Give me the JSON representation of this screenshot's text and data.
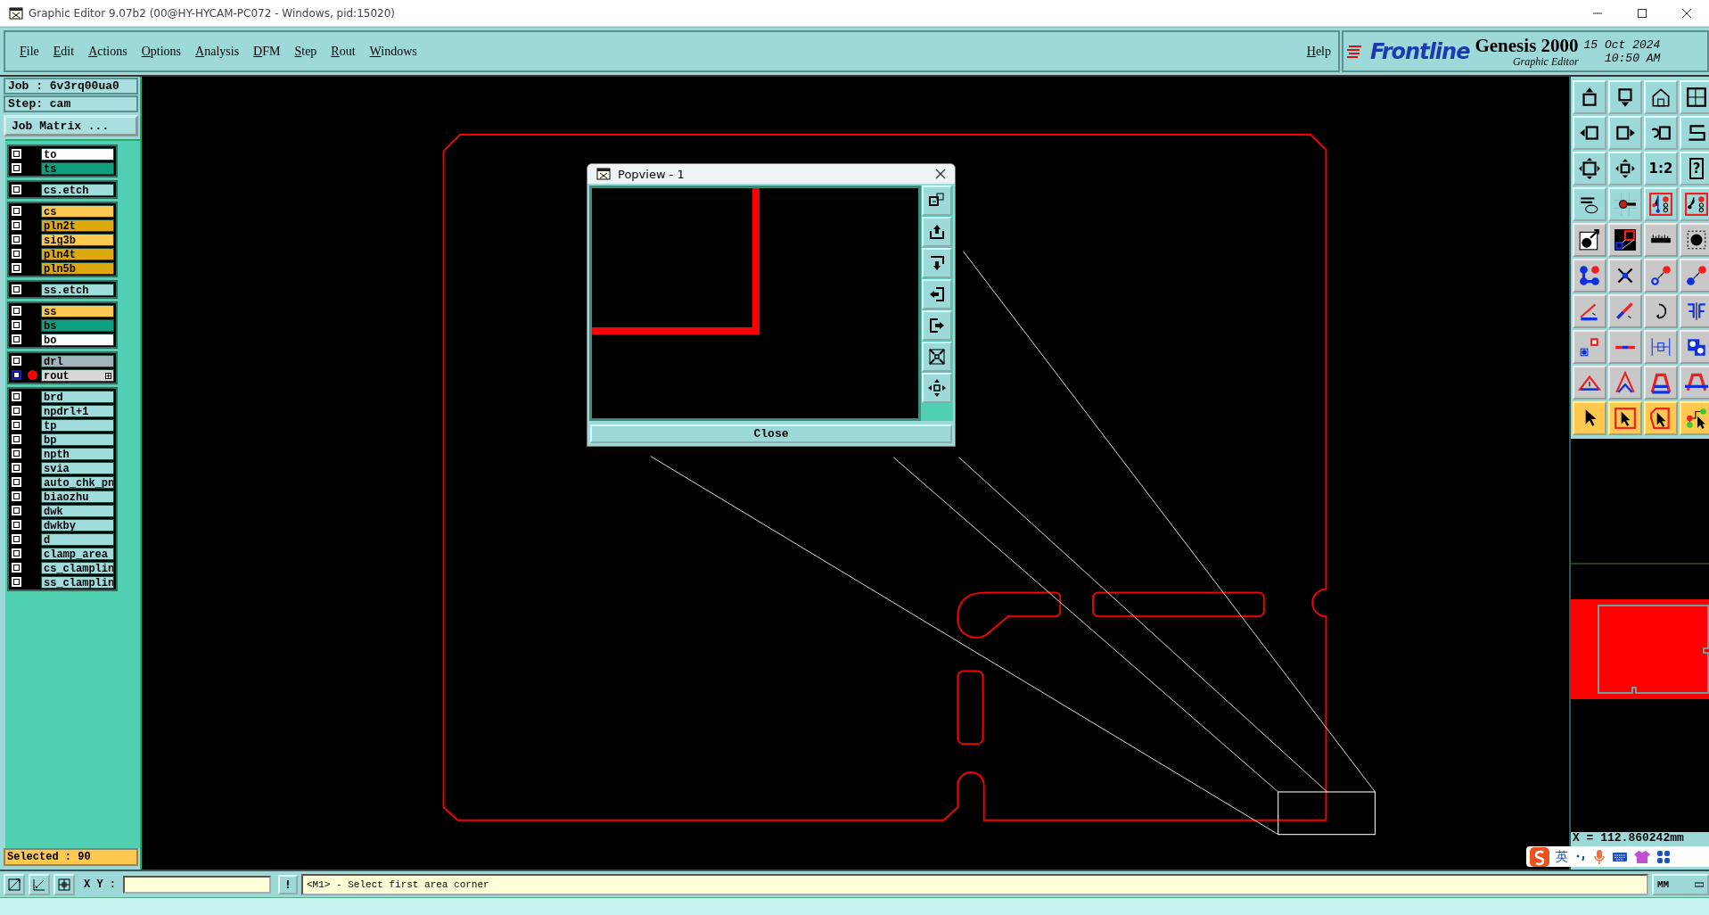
{
  "window": {
    "title": "Graphic Editor 9.07b2 (00@HY-HYCAM-PC072 - Windows, pid:15020)"
  },
  "menu": [
    "File",
    "Edit",
    "Actions",
    "Options",
    "Analysis",
    "DFM",
    "Step",
    "Rout",
    "Windows"
  ],
  "help": "Help",
  "brand": {
    "logo": "Frontline",
    "product": "Genesis 2000",
    "subtitle": "Graphic Editor",
    "date": "15 Oct 2024",
    "time": "10:50 AM"
  },
  "job": {
    "job": "Job : 6v3rq00ua0",
    "step": "Step: cam",
    "matrix_button": "Job Matrix ..."
  },
  "layer_groups": [
    {
      "layers": [
        {
          "name": "to",
          "color": "#ffffff",
          "selected": false,
          "marked": false
        },
        {
          "name": "ts",
          "color": "#10a080",
          "selected": false,
          "marked": false
        }
      ]
    },
    {
      "layers": [
        {
          "name": "cs.etch",
          "color": "#a0dcdc",
          "selected": false,
          "marked": false
        }
      ]
    },
    {
      "layers": [
        {
          "name": "cs",
          "color": "#ffc850",
          "selected": false,
          "marked": false
        },
        {
          "name": "pln2t",
          "color": "#e0a810",
          "selected": false,
          "marked": false
        },
        {
          "name": "sig3b",
          "color": "#ffc850",
          "selected": false,
          "marked": false
        },
        {
          "name": "pln4t",
          "color": "#e0a810",
          "selected": false,
          "marked": false
        },
        {
          "name": "pln5b",
          "color": "#e0a810",
          "selected": false,
          "marked": false
        }
      ]
    },
    {
      "layers": [
        {
          "name": "ss.etch",
          "color": "#a0dcdc",
          "selected": false,
          "marked": false
        }
      ]
    },
    {
      "layers": [
        {
          "name": "ss",
          "color": "#ffc850",
          "selected": false,
          "marked": false
        },
        {
          "name": "bs",
          "color": "#10a080",
          "selected": false,
          "marked": false
        },
        {
          "name": "bo",
          "color": "#ffffff",
          "selected": false,
          "marked": false
        }
      ]
    },
    {
      "layers": [
        {
          "name": "drl",
          "color": "#a0b4bc",
          "selected": false,
          "marked": false
        },
        {
          "name": "rout",
          "color": "#d8d8d8",
          "selected": true,
          "marked": true
        }
      ]
    },
    {
      "layers": [
        {
          "name": "brd",
          "color": "#a0dcdc",
          "selected": false,
          "marked": false
        },
        {
          "name": "npdrl+1",
          "color": "#a0dcdc",
          "selected": false,
          "marked": false
        },
        {
          "name": "tp",
          "color": "#a0dcdc",
          "selected": false,
          "marked": false
        },
        {
          "name": "bp",
          "color": "#a0dcdc",
          "selected": false,
          "marked": false
        },
        {
          "name": "npth",
          "color": "#a0dcdc",
          "selected": false,
          "marked": false
        },
        {
          "name": "svia",
          "color": "#a0dcdc",
          "selected": false,
          "marked": false
        },
        {
          "name": "auto_chk_pn",
          "color": "#a0dcdc",
          "selected": false,
          "marked": false
        },
        {
          "name": "biaozhu",
          "color": "#a0dcdc",
          "selected": false,
          "marked": false
        },
        {
          "name": "dwk",
          "color": "#a0dcdc",
          "selected": false,
          "marked": false
        },
        {
          "name": "dwkby",
          "color": "#a0dcdc",
          "selected": false,
          "marked": false
        },
        {
          "name": "d",
          "color": "#a0dcdc",
          "selected": false,
          "marked": false
        },
        {
          "name": "clamp_area",
          "color": "#a0dcdc",
          "selected": false,
          "marked": false
        },
        {
          "name": "cs_clamplin",
          "color": "#a0dcdc",
          "selected": false,
          "marked": false
        },
        {
          "name": "ss_clamplin",
          "color": "#a0dcdc",
          "selected": false,
          "marked": false
        }
      ]
    }
  ],
  "selected_count": "Selected : 90",
  "popview": {
    "title": "Popview - 1",
    "close": "Close"
  },
  "toolbox": {
    "labels": [
      "1:2",
      "?"
    ]
  },
  "coordinates": "X = 112.860242mm",
  "ime": {
    "language": "英"
  },
  "command": {
    "label": "X Y :",
    "hint_button": "!",
    "message": "<M1> - Select first area corner",
    "units": "MM"
  }
}
